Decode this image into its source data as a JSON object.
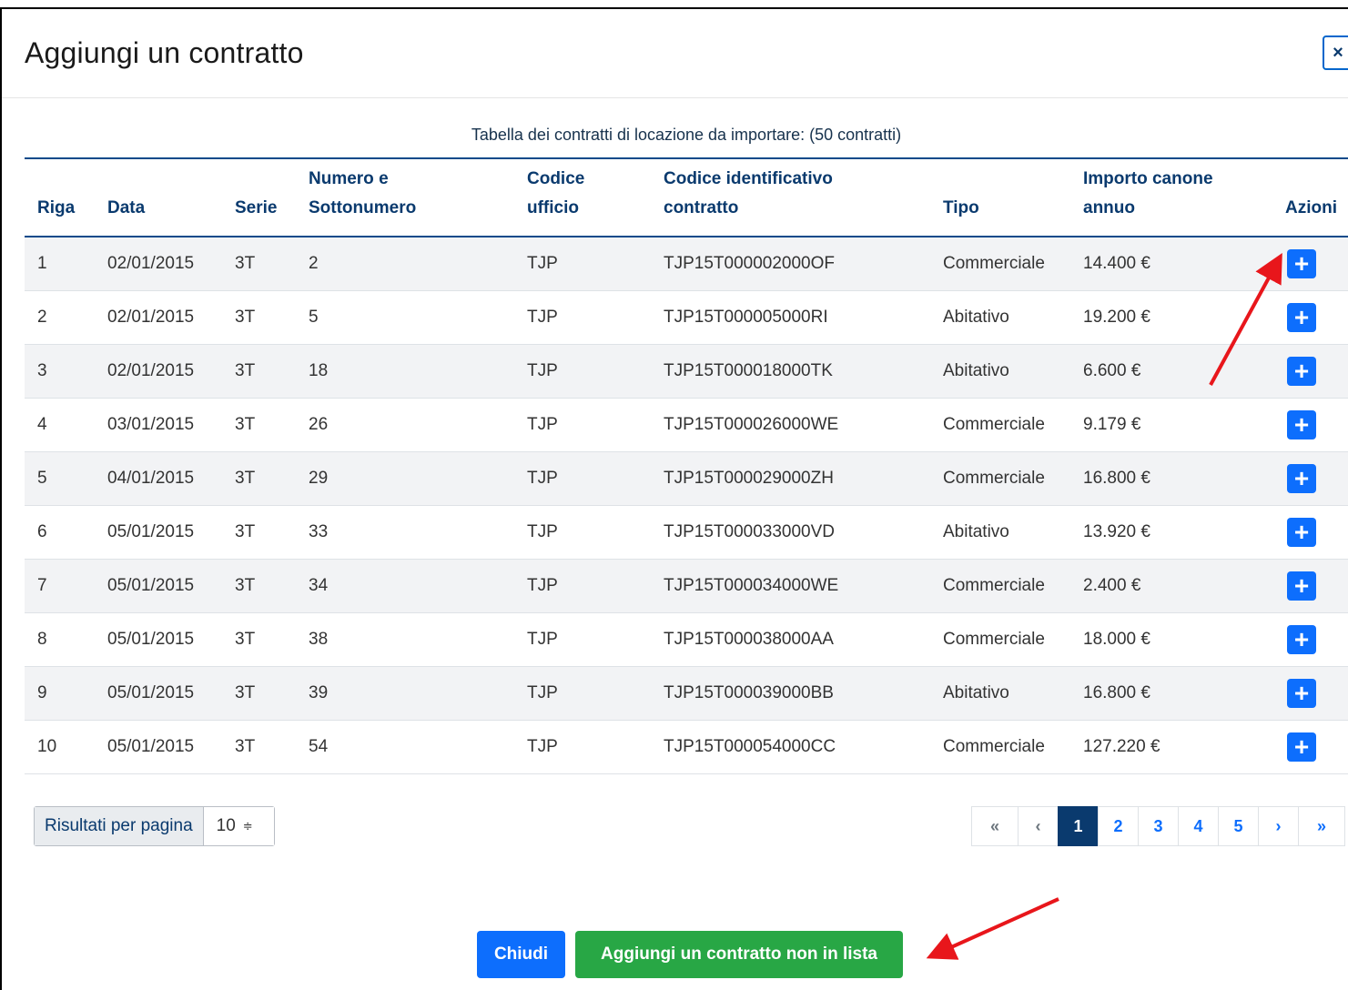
{
  "modal": {
    "title": "Aggiungi un contratto",
    "close_label": "×"
  },
  "table": {
    "caption": "Tabella dei contratti di locazione da importare: (50 contratti)",
    "headers": {
      "riga": "Riga",
      "data": "Data",
      "serie": "Serie",
      "numero_line1": "Numero e",
      "numero_line2": "Sottonumero",
      "ufficio_line1": "Codice",
      "ufficio_line2": "ufficio",
      "codice_line1": "Codice identificativo",
      "codice_line2": "contratto",
      "tipo": "Tipo",
      "importo_line1": "Importo canone",
      "importo_line2": "annuo",
      "azioni": "Azioni"
    },
    "rows": [
      {
        "riga": "1",
        "data": "02/01/2015",
        "serie": "3T",
        "numero": "2",
        "ufficio": "TJP",
        "codice": "TJP15T000002000OF",
        "tipo": "Commerciale",
        "importo": "14.400 €"
      },
      {
        "riga": "2",
        "data": "02/01/2015",
        "serie": "3T",
        "numero": "5",
        "ufficio": "TJP",
        "codice": "TJP15T000005000RI",
        "tipo": "Abitativo",
        "importo": "19.200 €"
      },
      {
        "riga": "3",
        "data": "02/01/2015",
        "serie": "3T",
        "numero": "18",
        "ufficio": "TJP",
        "codice": "TJP15T000018000TK",
        "tipo": "Abitativo",
        "importo": "6.600 €"
      },
      {
        "riga": "4",
        "data": "03/01/2015",
        "serie": "3T",
        "numero": "26",
        "ufficio": "TJP",
        "codice": "TJP15T000026000WE",
        "tipo": "Commerciale",
        "importo": "9.179 €"
      },
      {
        "riga": "5",
        "data": "04/01/2015",
        "serie": "3T",
        "numero": "29",
        "ufficio": "TJP",
        "codice": "TJP15T000029000ZH",
        "tipo": "Commerciale",
        "importo": "16.800 €"
      },
      {
        "riga": "6",
        "data": "05/01/2015",
        "serie": "3T",
        "numero": "33",
        "ufficio": "TJP",
        "codice": "TJP15T000033000VD",
        "tipo": "Abitativo",
        "importo": "13.920 €"
      },
      {
        "riga": "7",
        "data": "05/01/2015",
        "serie": "3T",
        "numero": "34",
        "ufficio": "TJP",
        "codice": "TJP15T000034000WE",
        "tipo": "Commerciale",
        "importo": "2.400 €"
      },
      {
        "riga": "8",
        "data": "05/01/2015",
        "serie": "3T",
        "numero": "38",
        "ufficio": "TJP",
        "codice": "TJP15T000038000AA",
        "tipo": "Commerciale",
        "importo": "18.000 €"
      },
      {
        "riga": "9",
        "data": "05/01/2015",
        "serie": "3T",
        "numero": "39",
        "ufficio": "TJP",
        "codice": "TJP15T000039000BB",
        "tipo": "Abitativo",
        "importo": "16.800 €"
      },
      {
        "riga": "10",
        "data": "05/01/2015",
        "serie": "3T",
        "numero": "54",
        "ufficio": "TJP",
        "codice": "TJP15T000054000CC",
        "tipo": "Commerciale",
        "importo": "127.220 €"
      }
    ],
    "add_icon": "plus-icon",
    "add_glyph": "+"
  },
  "pagination": {
    "per_page_label": "Risultati per pagina",
    "per_page_value": "10",
    "per_page_chevron": "≑",
    "first": "«",
    "prev": "‹",
    "pages": [
      "1",
      "2",
      "3",
      "4",
      "5"
    ],
    "active_page": "1",
    "next": "›",
    "last": "»"
  },
  "footer": {
    "close_label": "Chiudi",
    "add_label": "Aggiungi un contratto non in lista"
  },
  "colors": {
    "primary": "#0d6efd",
    "success": "#28a745",
    "header_text": "#0a3a6e",
    "annotation_arrow": "#e8161b"
  }
}
